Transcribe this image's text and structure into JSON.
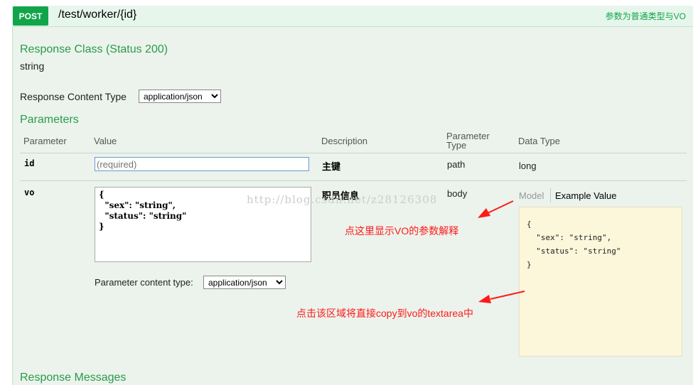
{
  "header": {
    "method": "POST",
    "path": "/test/worker/{id}",
    "summary": "参数为普通类型与VO"
  },
  "response_class": {
    "title": "Response Class (Status 200)",
    "type": "string"
  },
  "response_content_type": {
    "label": "Response Content Type",
    "selected": "application/json"
  },
  "parameters": {
    "title": "Parameters",
    "columns": {
      "parameter": "Parameter",
      "value": "Value",
      "description": "Description",
      "parameter_type_line1": "Parameter",
      "parameter_type_line2": "Type",
      "data_type": "Data Type"
    },
    "rows": [
      {
        "name": "id",
        "placeholder": "(required)",
        "description": "主键",
        "param_type": "path",
        "data_type": "long"
      },
      {
        "name": "vo",
        "value": "{\n  \"sex\": \"string\",\n  \"status\": \"string\"\n}",
        "description": "职员信息",
        "param_type": "body",
        "content_type_label": "Parameter content type:",
        "content_type_selected": "application/json",
        "model_tab": "Model",
        "example_tab": "Example Value",
        "example_value": "{\n  \"sex\": \"string\",\n  \"status\": \"string\"\n}"
      }
    ]
  },
  "annotations": {
    "note1": "点这里显示VO的参数解释",
    "note2": "点击该区域将直接copy到vo的textarea中",
    "annotation_color": "#ff1a1a"
  },
  "watermark": "http://blog.csdn.net/z28126308",
  "response_messages": {
    "title": "Response Messages"
  },
  "colors": {
    "method_bg": "#10a54a",
    "section_bg": "#ebf3ec",
    "heading_green": "#2a9b4b",
    "example_bg": "#fcf6db"
  }
}
